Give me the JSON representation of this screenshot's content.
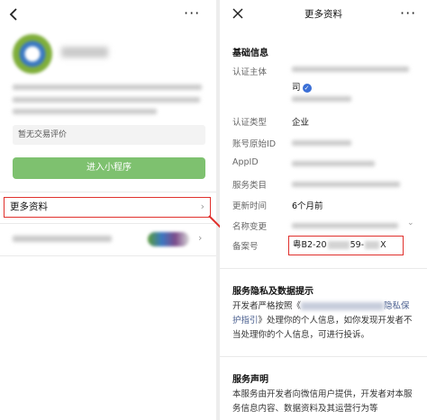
{
  "left": {
    "enter_button": "进入小程序",
    "rating_text": "暂无交易评价",
    "more_info": "更多资料",
    "chevron": "›",
    "more_dots": "···"
  },
  "right": {
    "header_title": "更多资料",
    "more_dots": "···",
    "basic_info_title": "基础信息",
    "fields": [
      {
        "label": "认证主体",
        "value": "司"
      },
      {
        "label": "认证类型",
        "value": "企业"
      },
      {
        "label": "账号原始ID",
        "value": ""
      },
      {
        "label": "AppID",
        "value": ""
      },
      {
        "label": "服务类目",
        "value": ""
      },
      {
        "label": "更新时间",
        "value": "6个月前"
      },
      {
        "label": "名称变更",
        "value": ""
      },
      {
        "label": "备案号",
        "value": ""
      }
    ],
    "icp": {
      "prefix": "粤B2-20",
      "middle": "59-",
      "suffix": "X"
    },
    "privacy_title": "服务隐私及数据提示",
    "privacy_text_1": "开发者严格按照《",
    "privacy_link_tail": "隐私保护指引",
    "privacy_text_2": "》处理你的个人信息，如你发现开发者不当处理你的个人信息，可进行投诉。",
    "statement_title": "服务声明",
    "statement_text": "本服务由开发者向微信用户提供，开发者对本服务信息内容、数据资料及其运营行为等"
  },
  "colors": {
    "accent_green": "#7ec16f",
    "highlight_red": "#e0302c",
    "link_blue": "#4a5f8f"
  }
}
